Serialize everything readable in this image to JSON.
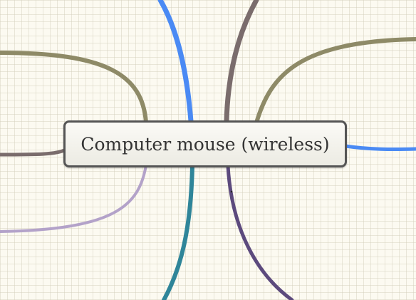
{
  "central_topic": "Computer mouse (wireless)",
  "branches": [
    {
      "id": "branch-top-blue",
      "color": "#4a8af4"
    },
    {
      "id": "branch-top-brown",
      "color": "#7a6c6c"
    },
    {
      "id": "branch-top-right-olive",
      "color": "#8e8a67"
    },
    {
      "id": "branch-right-blue",
      "color": "#4a8af4"
    },
    {
      "id": "branch-top-left-olive",
      "color": "#8e8a67"
    },
    {
      "id": "branch-left-brown",
      "color": "#7a6c6c"
    },
    {
      "id": "branch-left-lavender",
      "color": "#b3a2c9"
    },
    {
      "id": "branch-bottom-teal",
      "color": "#2f8599"
    },
    {
      "id": "branch-bottom-purple",
      "color": "#5c4a7d"
    }
  ],
  "background_color": "#fcfaf1"
}
